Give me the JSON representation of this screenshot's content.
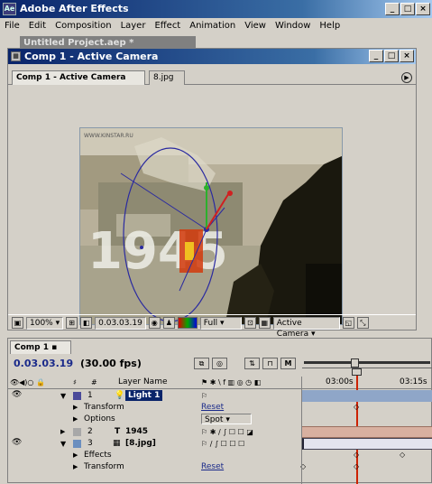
{
  "app": {
    "title": "Adobe After Effects",
    "icon": "after-effects-logo"
  },
  "menu": [
    "File",
    "Edit",
    "Composition",
    "Layer",
    "Effect",
    "Animation",
    "View",
    "Window",
    "Help"
  ],
  "background_window": {
    "title": "Untitled Project.aep *"
  },
  "comp_window": {
    "title": "Comp 1 - Active Camera",
    "tabs": [
      "Comp 1 - Active Camera",
      "8.jpg"
    ]
  },
  "footage": {
    "watermark": "WWW.KINSTAR.RU",
    "year_text": "1945"
  },
  "viewer_bar": {
    "zoom": "100%",
    "timecode": "0.03.03.19",
    "resolution": "Full",
    "camera": "Active Camera"
  },
  "timeline": {
    "tab": "Comp 1",
    "timecode": "0.03.03.19",
    "fps": "(30.00 fps)",
    "column_header": "Layer Name",
    "ruler": {
      "marks": [
        "03:00s",
        "03:15s"
      ]
    },
    "layers": [
      {
        "num": "1",
        "name": "Light 1",
        "props": [
          "Transform",
          "Options"
        ],
        "reset": "Reset",
        "option_value": "Spot"
      },
      {
        "num": "2",
        "name": "1945",
        "type": "T"
      },
      {
        "num": "3",
        "name": "[8.jpg]",
        "props": [
          "Effects",
          "Transform"
        ],
        "reset": "Reset"
      }
    ]
  },
  "colors": {
    "title_blue": "#0a246a",
    "label_light": "#4b4b9a",
    "label_text": "#a8a8a8",
    "label_footage": "#6b8fbf",
    "cti_red": "#cc2200"
  }
}
